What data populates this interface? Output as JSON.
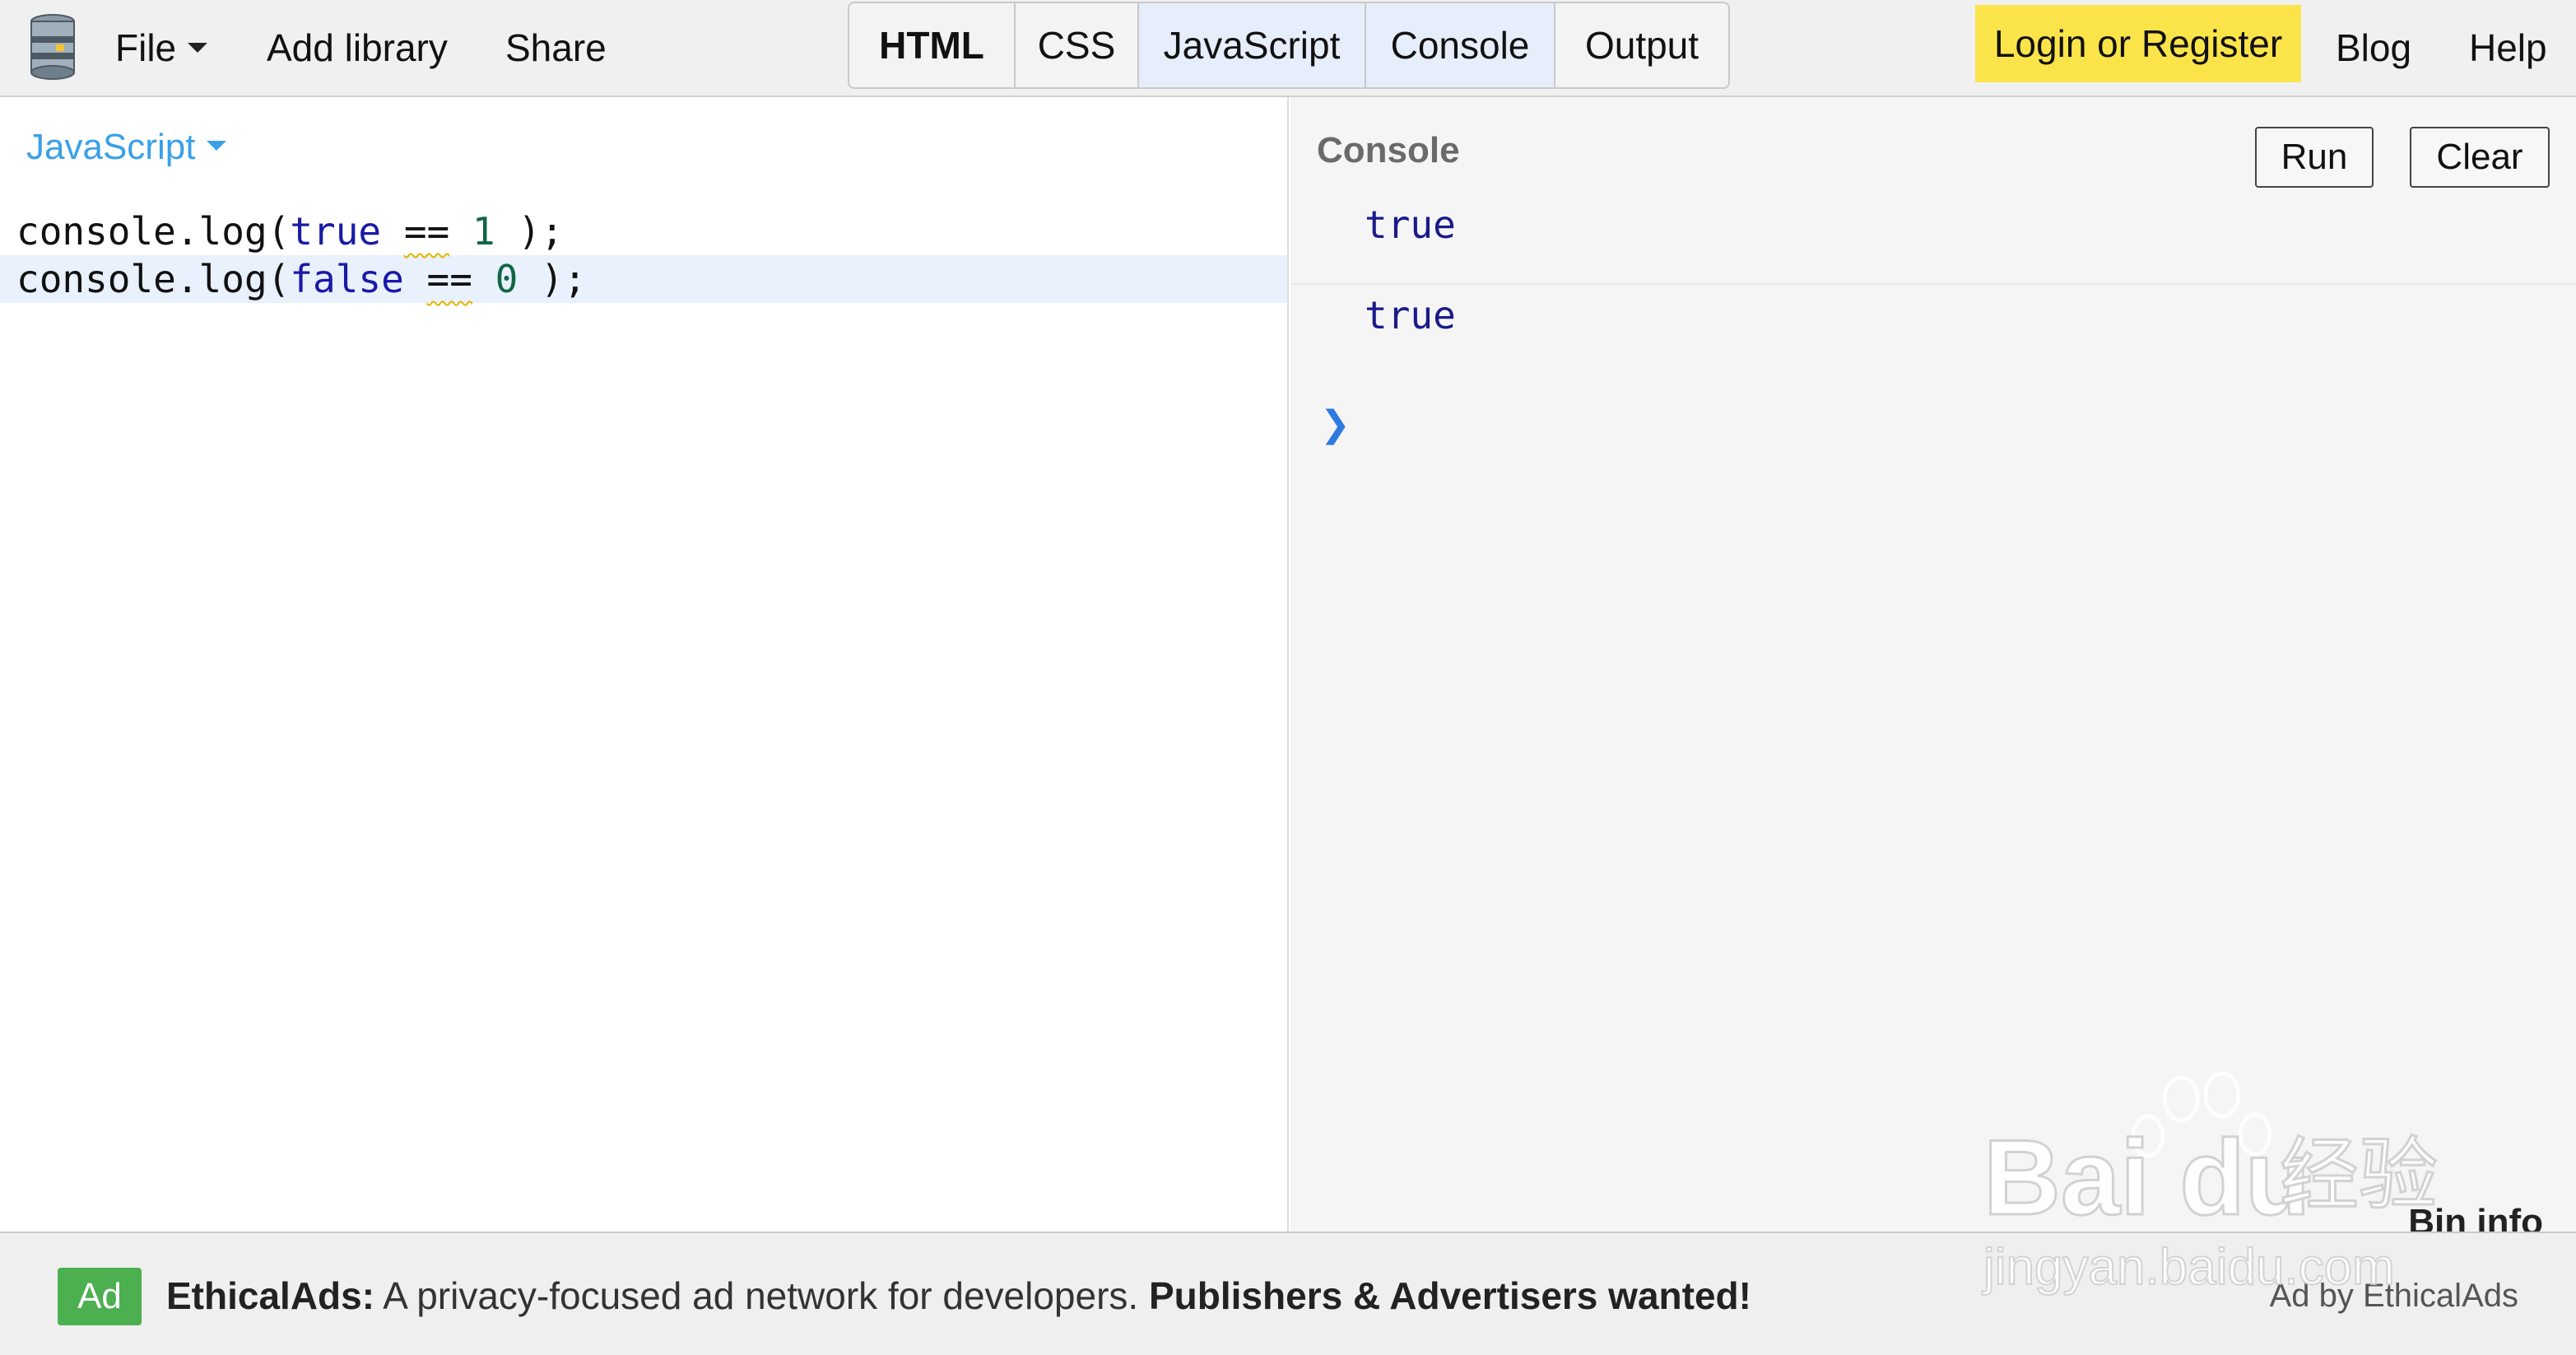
{
  "topbar": {
    "menu": {
      "file": "File",
      "add_library": "Add library",
      "share": "Share"
    },
    "tabs": [
      {
        "label": "HTML",
        "bold": true,
        "active": false
      },
      {
        "label": "CSS",
        "bold": false,
        "active": false
      },
      {
        "label": "JavaScript",
        "bold": false,
        "active": true
      },
      {
        "label": "Console",
        "bold": false,
        "active": true
      },
      {
        "label": "Output",
        "bold": false,
        "active": false
      }
    ],
    "login": "Login or Register",
    "blog": "Blog",
    "help": "Help"
  },
  "editor": {
    "language": "JavaScript",
    "lines": [
      {
        "pre": "console.log(",
        "kw": "true",
        "op": "==",
        "num": "1",
        "post": " );"
      },
      {
        "pre": "console.log(",
        "kw": "false",
        "op": "==",
        "num": "0",
        "post": " );"
      }
    ]
  },
  "console": {
    "title": "Console",
    "run_label": "Run",
    "clear_label": "Clear",
    "output": [
      "true",
      "true"
    ],
    "prompt": "❯",
    "bin_info": "Bin info"
  },
  "ad": {
    "badge": "Ad",
    "brand": "EthicalAds:",
    "message": " A privacy-focused ad network for developers. ",
    "cta": "Publishers & Advertisers wanted!",
    "by": "Ad by EthicalAds"
  },
  "watermark": {
    "brand": "Bai du",
    "chinese": "经验",
    "url": "jingyan.baidu.com"
  },
  "colors": {
    "accent_blue": "#3aa0e8",
    "login_yellow": "#fbe44a",
    "ad_green": "#4caf50",
    "active_tab": "#e6eefb"
  }
}
